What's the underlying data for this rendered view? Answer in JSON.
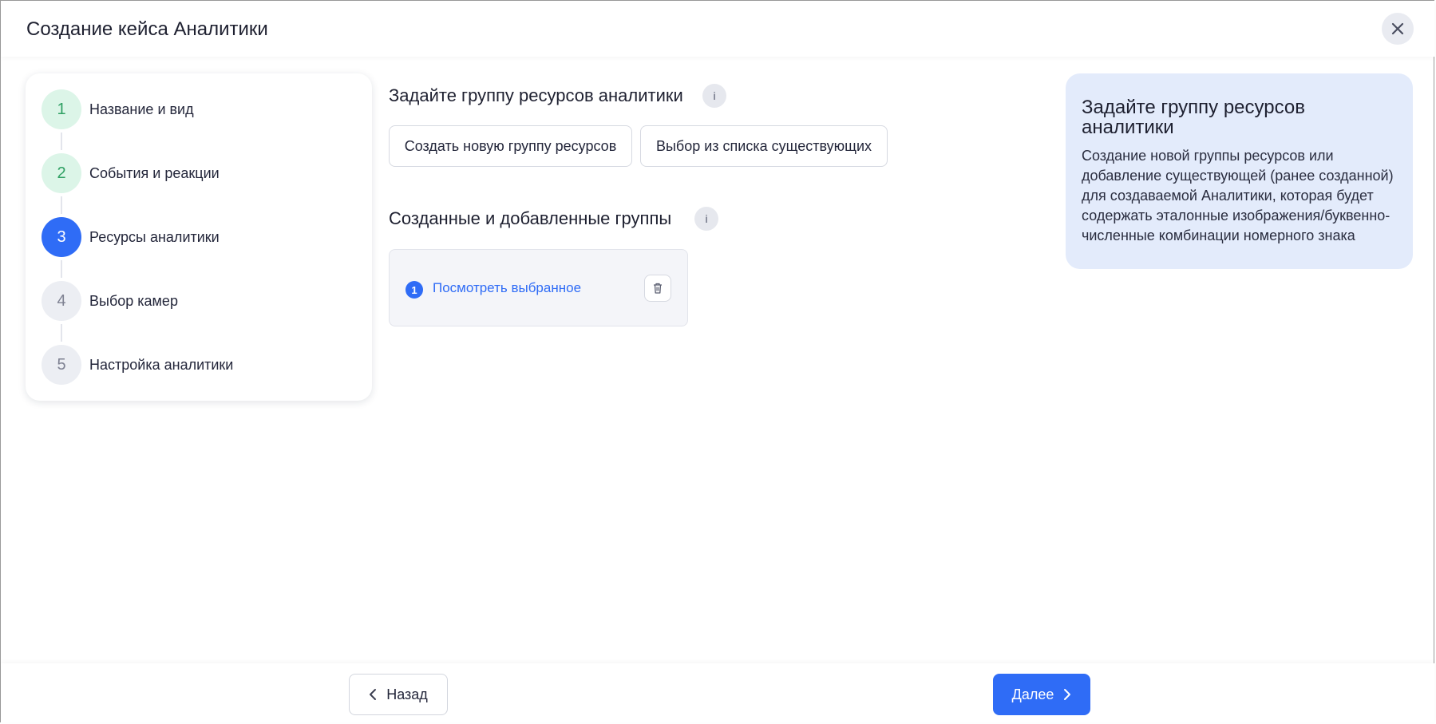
{
  "header": {
    "title": "Создание кейса Аналитики"
  },
  "steps": [
    {
      "number": "1",
      "label": "Название и вид",
      "state": "done"
    },
    {
      "number": "2",
      "label": "События и реакции",
      "state": "done"
    },
    {
      "number": "3",
      "label": "Ресурсы аналитики",
      "state": "active"
    },
    {
      "number": "4",
      "label": "Выбор камер",
      "state": "todo"
    },
    {
      "number": "5",
      "label": "Настройка аналитики",
      "state": "todo"
    }
  ],
  "main": {
    "section1_title": "Задайте группу ресурсов аналитики",
    "info_glyph": "i",
    "create_button": "Создать новую группу ресурсов",
    "select_button": "Выбор из списка существующих",
    "section2_title": "Созданные и добавленные группы",
    "group": {
      "count": "1",
      "link_label": "Посмотреть выбранное"
    }
  },
  "help": {
    "title": "Задайте группу ресурсов аналитики",
    "text": "Создание новой группы ресурсов или добавление существующей (ранее созданной) для создаваемой Аналитики, которая будет содержать эталонные изображения/буквенно-численные комбинации номерного знака"
  },
  "footer": {
    "back_label": "Назад",
    "next_label": "Далее"
  },
  "colors": {
    "accent": "#2f6cf6",
    "done_bg": "#dcf5e8",
    "done_text": "#2fa063",
    "todo_bg": "#eceef3",
    "help_bg": "#e3ebfb"
  },
  "icons": {
    "close": "close-icon",
    "trash": "trash-icon",
    "back": "chevron-left-icon",
    "next": "chevron-right-icon",
    "info": "info-icon"
  }
}
